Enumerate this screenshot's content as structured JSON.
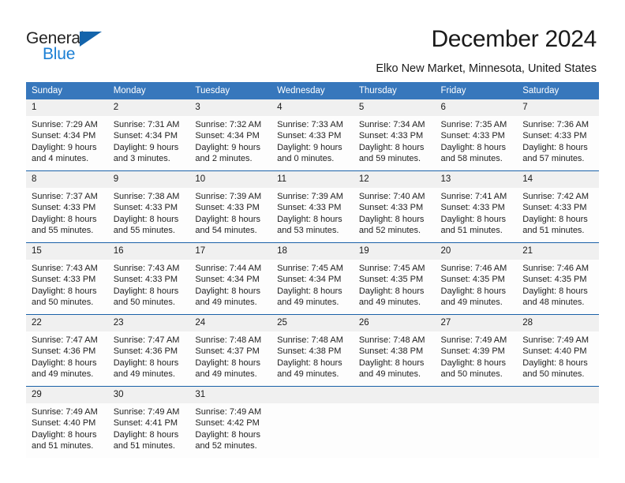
{
  "logo": {
    "word1": "General",
    "word2": "Blue",
    "triangle_color": "#1464ab",
    "blue_text_color": "#1b7fd4"
  },
  "header": {
    "title": "December 2024",
    "subtitle": "Elko New Market, Minnesota, United States"
  },
  "theme": {
    "header_blue": "#3777bc",
    "row_divider_blue": "#1b61a8",
    "daynum_band": "#f0f0f0"
  },
  "calendar": {
    "weekdays": [
      "Sunday",
      "Monday",
      "Tuesday",
      "Wednesday",
      "Thursday",
      "Friday",
      "Saturday"
    ],
    "weeks": [
      [
        {
          "day": "1",
          "sunrise": "Sunrise: 7:29 AM",
          "sunset": "Sunset: 4:34 PM",
          "daylight1": "Daylight: 9 hours",
          "daylight2": "and 4 minutes."
        },
        {
          "day": "2",
          "sunrise": "Sunrise: 7:31 AM",
          "sunset": "Sunset: 4:34 PM",
          "daylight1": "Daylight: 9 hours",
          "daylight2": "and 3 minutes."
        },
        {
          "day": "3",
          "sunrise": "Sunrise: 7:32 AM",
          "sunset": "Sunset: 4:34 PM",
          "daylight1": "Daylight: 9 hours",
          "daylight2": "and 2 minutes."
        },
        {
          "day": "4",
          "sunrise": "Sunrise: 7:33 AM",
          "sunset": "Sunset: 4:33 PM",
          "daylight1": "Daylight: 9 hours",
          "daylight2": "and 0 minutes."
        },
        {
          "day": "5",
          "sunrise": "Sunrise: 7:34 AM",
          "sunset": "Sunset: 4:33 PM",
          "daylight1": "Daylight: 8 hours",
          "daylight2": "and 59 minutes."
        },
        {
          "day": "6",
          "sunrise": "Sunrise: 7:35 AM",
          "sunset": "Sunset: 4:33 PM",
          "daylight1": "Daylight: 8 hours",
          "daylight2": "and 58 minutes."
        },
        {
          "day": "7",
          "sunrise": "Sunrise: 7:36 AM",
          "sunset": "Sunset: 4:33 PM",
          "daylight1": "Daylight: 8 hours",
          "daylight2": "and 57 minutes."
        }
      ],
      [
        {
          "day": "8",
          "sunrise": "Sunrise: 7:37 AM",
          "sunset": "Sunset: 4:33 PM",
          "daylight1": "Daylight: 8 hours",
          "daylight2": "and 55 minutes."
        },
        {
          "day": "9",
          "sunrise": "Sunrise: 7:38 AM",
          "sunset": "Sunset: 4:33 PM",
          "daylight1": "Daylight: 8 hours",
          "daylight2": "and 55 minutes."
        },
        {
          "day": "10",
          "sunrise": "Sunrise: 7:39 AM",
          "sunset": "Sunset: 4:33 PM",
          "daylight1": "Daylight: 8 hours",
          "daylight2": "and 54 minutes."
        },
        {
          "day": "11",
          "sunrise": "Sunrise: 7:39 AM",
          "sunset": "Sunset: 4:33 PM",
          "daylight1": "Daylight: 8 hours",
          "daylight2": "and 53 minutes."
        },
        {
          "day": "12",
          "sunrise": "Sunrise: 7:40 AM",
          "sunset": "Sunset: 4:33 PM",
          "daylight1": "Daylight: 8 hours",
          "daylight2": "and 52 minutes."
        },
        {
          "day": "13",
          "sunrise": "Sunrise: 7:41 AM",
          "sunset": "Sunset: 4:33 PM",
          "daylight1": "Daylight: 8 hours",
          "daylight2": "and 51 minutes."
        },
        {
          "day": "14",
          "sunrise": "Sunrise: 7:42 AM",
          "sunset": "Sunset: 4:33 PM",
          "daylight1": "Daylight: 8 hours",
          "daylight2": "and 51 minutes."
        }
      ],
      [
        {
          "day": "15",
          "sunrise": "Sunrise: 7:43 AM",
          "sunset": "Sunset: 4:33 PM",
          "daylight1": "Daylight: 8 hours",
          "daylight2": "and 50 minutes."
        },
        {
          "day": "16",
          "sunrise": "Sunrise: 7:43 AM",
          "sunset": "Sunset: 4:33 PM",
          "daylight1": "Daylight: 8 hours",
          "daylight2": "and 50 minutes."
        },
        {
          "day": "17",
          "sunrise": "Sunrise: 7:44 AM",
          "sunset": "Sunset: 4:34 PM",
          "daylight1": "Daylight: 8 hours",
          "daylight2": "and 49 minutes."
        },
        {
          "day": "18",
          "sunrise": "Sunrise: 7:45 AM",
          "sunset": "Sunset: 4:34 PM",
          "daylight1": "Daylight: 8 hours",
          "daylight2": "and 49 minutes."
        },
        {
          "day": "19",
          "sunrise": "Sunrise: 7:45 AM",
          "sunset": "Sunset: 4:35 PM",
          "daylight1": "Daylight: 8 hours",
          "daylight2": "and 49 minutes."
        },
        {
          "day": "20",
          "sunrise": "Sunrise: 7:46 AM",
          "sunset": "Sunset: 4:35 PM",
          "daylight1": "Daylight: 8 hours",
          "daylight2": "and 49 minutes."
        },
        {
          "day": "21",
          "sunrise": "Sunrise: 7:46 AM",
          "sunset": "Sunset: 4:35 PM",
          "daylight1": "Daylight: 8 hours",
          "daylight2": "and 48 minutes."
        }
      ],
      [
        {
          "day": "22",
          "sunrise": "Sunrise: 7:47 AM",
          "sunset": "Sunset: 4:36 PM",
          "daylight1": "Daylight: 8 hours",
          "daylight2": "and 49 minutes."
        },
        {
          "day": "23",
          "sunrise": "Sunrise: 7:47 AM",
          "sunset": "Sunset: 4:36 PM",
          "daylight1": "Daylight: 8 hours",
          "daylight2": "and 49 minutes."
        },
        {
          "day": "24",
          "sunrise": "Sunrise: 7:48 AM",
          "sunset": "Sunset: 4:37 PM",
          "daylight1": "Daylight: 8 hours",
          "daylight2": "and 49 minutes."
        },
        {
          "day": "25",
          "sunrise": "Sunrise: 7:48 AM",
          "sunset": "Sunset: 4:38 PM",
          "daylight1": "Daylight: 8 hours",
          "daylight2": "and 49 minutes."
        },
        {
          "day": "26",
          "sunrise": "Sunrise: 7:48 AM",
          "sunset": "Sunset: 4:38 PM",
          "daylight1": "Daylight: 8 hours",
          "daylight2": "and 49 minutes."
        },
        {
          "day": "27",
          "sunrise": "Sunrise: 7:49 AM",
          "sunset": "Sunset: 4:39 PM",
          "daylight1": "Daylight: 8 hours",
          "daylight2": "and 50 minutes."
        },
        {
          "day": "28",
          "sunrise": "Sunrise: 7:49 AM",
          "sunset": "Sunset: 4:40 PM",
          "daylight1": "Daylight: 8 hours",
          "daylight2": "and 50 minutes."
        }
      ],
      [
        {
          "day": "29",
          "sunrise": "Sunrise: 7:49 AM",
          "sunset": "Sunset: 4:40 PM",
          "daylight1": "Daylight: 8 hours",
          "daylight2": "and 51 minutes."
        },
        {
          "day": "30",
          "sunrise": "Sunrise: 7:49 AM",
          "sunset": "Sunset: 4:41 PM",
          "daylight1": "Daylight: 8 hours",
          "daylight2": "and 51 minutes."
        },
        {
          "day": "31",
          "sunrise": "Sunrise: 7:49 AM",
          "sunset": "Sunset: 4:42 PM",
          "daylight1": "Daylight: 8 hours",
          "daylight2": "and 52 minutes."
        },
        {
          "day": "",
          "sunrise": "",
          "sunset": "",
          "daylight1": "",
          "daylight2": ""
        },
        {
          "day": "",
          "sunrise": "",
          "sunset": "",
          "daylight1": "",
          "daylight2": ""
        },
        {
          "day": "",
          "sunrise": "",
          "sunset": "",
          "daylight1": "",
          "daylight2": ""
        },
        {
          "day": "",
          "sunrise": "",
          "sunset": "",
          "daylight1": "",
          "daylight2": ""
        }
      ]
    ]
  }
}
